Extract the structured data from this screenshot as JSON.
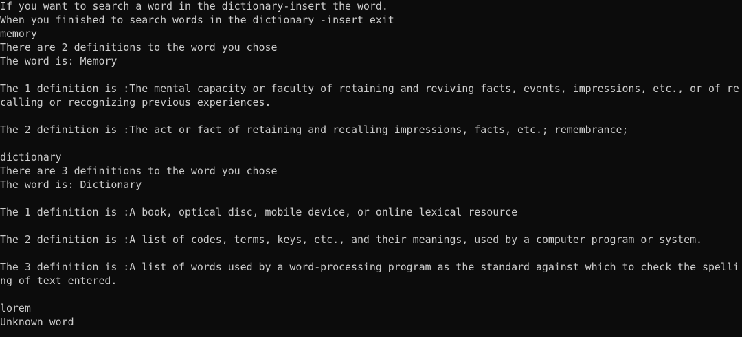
{
  "console": {
    "lines": [
      "If you want to search a word in the dictionary-insert the word.",
      "When you finished to search words in the dictionary -insert exit",
      "memory",
      "There are 2 definitions to the word you chose",
      "The word is: Memory",
      "",
      "The 1 definition is :The mental capacity or faculty of retaining and reviving facts, events, impressions, etc., or of re",
      "calling or recognizing previous experiences.",
      "",
      "The 2 definition is :The act or fact of retaining and recalling impressions, facts, etc.; remembrance;",
      "",
      "dictionary",
      "There are 3 definitions to the word you chose",
      "The word is: Dictionary",
      "",
      "The 1 definition is :A book, optical disc, mobile device, or online lexical resource",
      "",
      "The 2 definition is :A list of codes, terms, keys, etc., and their meanings, used by a computer program or system.",
      "",
      "The 3 definition is :A list of words used by a word-processing program as the standard against which to check the spelli",
      "ng of text entered.",
      "",
      "lorem",
      "Unknown word"
    ]
  }
}
